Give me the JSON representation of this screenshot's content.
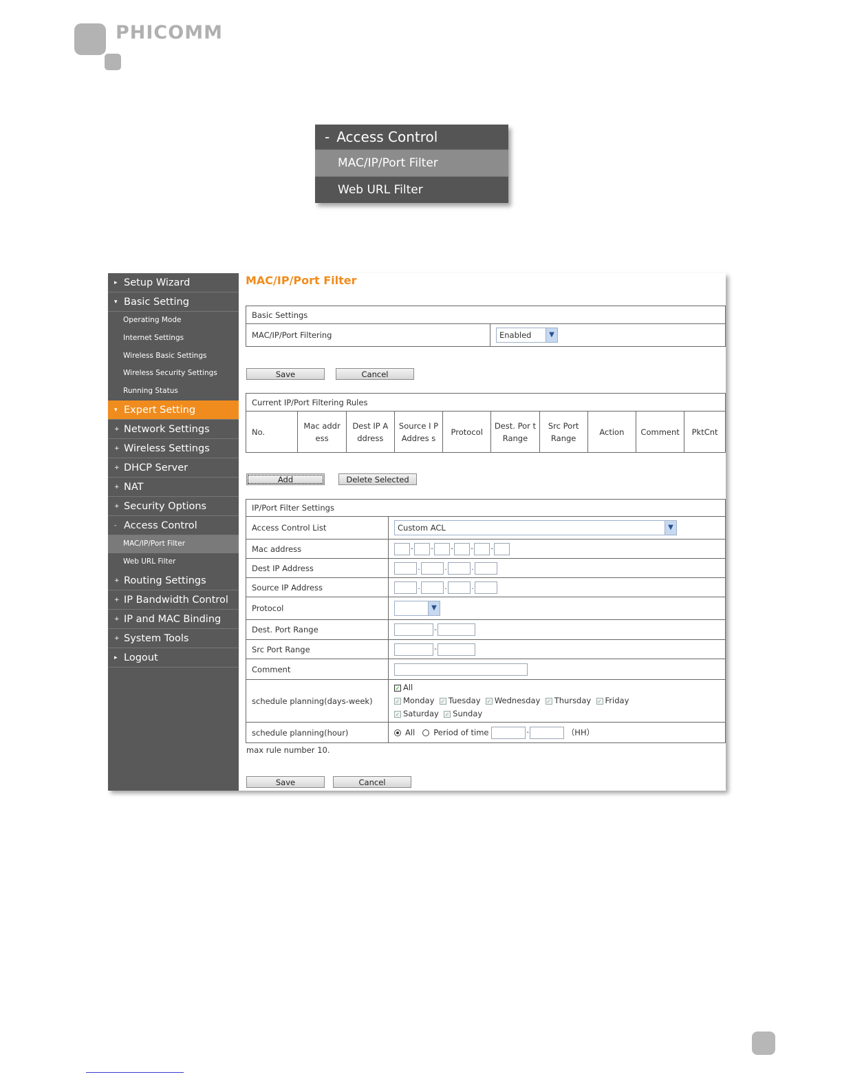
{
  "logo": {
    "brand": "PHICOMM"
  },
  "popup": {
    "header": "Access Control",
    "items": [
      "MAC/IP/Port Filter",
      "Web URL Filter"
    ]
  },
  "sidebar": {
    "items": [
      {
        "label": "Setup Wizard"
      },
      {
        "label": "Basic Setting"
      },
      {
        "label": "Operating Mode"
      },
      {
        "label": "Internet Settings"
      },
      {
        "label": "Wireless Basic Settings"
      },
      {
        "label": "Wireless Security Settings"
      },
      {
        "label": "Running Status"
      },
      {
        "label": "Expert Setting"
      },
      {
        "label": "Network Settings"
      },
      {
        "label": "Wireless Settings"
      },
      {
        "label": "DHCP Server"
      },
      {
        "label": "NAT"
      },
      {
        "label": "Security Options"
      },
      {
        "label": "Access Control"
      },
      {
        "label": "MAC/IP/Port Filter"
      },
      {
        "label": "Web URL Filter"
      },
      {
        "label": "Routing Settings"
      },
      {
        "label": "IP Bandwidth Control"
      },
      {
        "label": "IP and MAC Binding"
      },
      {
        "label": "System Tools"
      },
      {
        "label": "Logout"
      }
    ]
  },
  "page": {
    "title": "MAC/IP/Port Filter"
  },
  "basic": {
    "header": "Basic Settings",
    "filter_label": "MAC/IP/Port Filtering",
    "filter_value": "Enabled"
  },
  "buttons": {
    "save": "Save",
    "cancel": "Cancel",
    "add": "Add",
    "delete_selected": "Delete Selected"
  },
  "rules": {
    "header": "Current IP/Port Filtering Rules",
    "columns": [
      "No.",
      "Mac addr ess",
      "Dest IP A ddress",
      "Source I P Addres s",
      "Protocol",
      "Dest. Por t Range",
      "Src Port Range",
      "Action",
      "Comment",
      "PktCnt"
    ]
  },
  "filter": {
    "header": "IP/Port Filter Settings",
    "acl_label": "Access Control List",
    "acl_value": "Custom ACL",
    "mac_label": "Mac address",
    "dest_ip_label": "Dest IP Address",
    "src_ip_label": "Source IP Address",
    "protocol_label": "Protocol",
    "dest_port_label": "Dest. Port Range",
    "src_port_label": "Src Port Range",
    "comment_label": "Comment",
    "days_label": "schedule planning(days-week)",
    "days": {
      "all": "All",
      "mon": "Monday",
      "tue": "Tuesday",
      "wed": "Wednesday",
      "thu": "Thursday",
      "fri": "Friday",
      "sat": "Saturday",
      "sun": "Sunday"
    },
    "hour_label": "schedule planning(hour)",
    "hour_all": "All",
    "hour_period": "Period of time",
    "hour_unit": "（HH）",
    "note": "max rule number 10."
  }
}
